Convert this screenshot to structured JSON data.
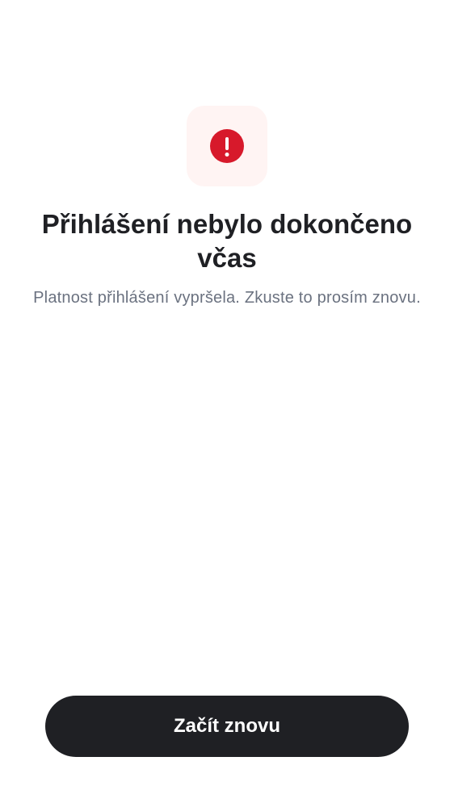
{
  "screen": {
    "alert_icon": "exclamation-circle-icon",
    "alert_color": "#d7192b",
    "title": "Přihlášení nebylo dokončeno včas",
    "message": "Platnost přihlášení vypršela. Zkuste to prosím znovu.",
    "restart_button_label": "Začít znovu"
  }
}
